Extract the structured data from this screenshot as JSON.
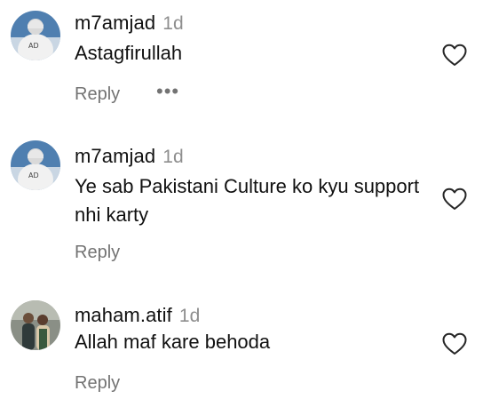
{
  "comments": [
    {
      "username": "m7amjad",
      "time": "1d",
      "text": "Astagfirullah",
      "reply_label": "Reply",
      "more_label": "•••"
    },
    {
      "username": "m7amjad",
      "time": "1d",
      "text": "Ye sab Pakistani Culture ko kyu support nhi karty",
      "reply_label": "Reply"
    },
    {
      "username": "maham.atif",
      "time": "1d",
      "text": "Allah maf kare behoda",
      "reply_label": "Reply"
    }
  ],
  "icons": {
    "like": "heart-outline-icon",
    "more": "more-dots-icon"
  },
  "colors": {
    "secondary_text": "#737373",
    "timestamp": "#8e8e8e",
    "primary_text": "#111111"
  }
}
